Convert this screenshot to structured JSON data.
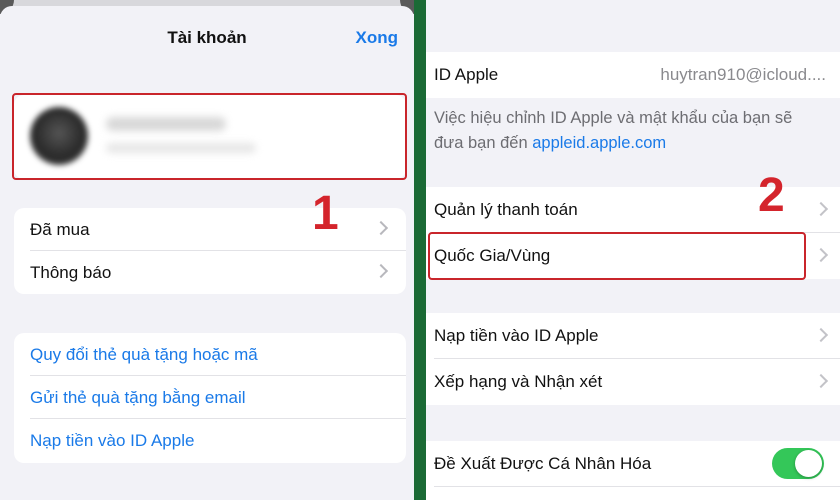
{
  "left": {
    "title": "Tài khoản",
    "done_label": "Xong",
    "group_a": [
      {
        "label": "Đã mua"
      },
      {
        "label": "Thông báo"
      }
    ],
    "group_b": [
      {
        "label": "Quy đổi thẻ quà tặng hoặc mã"
      },
      {
        "label": "Gửi thẻ quà tặng bằng email"
      },
      {
        "label": "Nạp tiền vào ID Apple"
      }
    ],
    "step_number": "1"
  },
  "right": {
    "apple_id_label": "ID Apple",
    "apple_id_value": "huytran910@icloud....",
    "note_text": "Việc hiệu chỉnh ID Apple và mật khẩu của bạn sẽ đưa bạn đến",
    "note_link": "appleid.apple.com",
    "group2": [
      {
        "label": "Quản lý thanh toán"
      },
      {
        "label": "Quốc Gia/Vùng"
      }
    ],
    "group3": [
      {
        "label": "Nạp tiền vào ID Apple"
      },
      {
        "label": "Xếp hạng và Nhận xét"
      }
    ],
    "personalized_label": "Đề Xuất Được Cá Nhân Hóa",
    "personalized_on": true,
    "step_number": "2"
  },
  "colors": {
    "accent_blue": "#1a7ae8",
    "highlight_red": "#c9252b",
    "toggle_green": "#34c759",
    "divider_green": "#1b6a35"
  }
}
